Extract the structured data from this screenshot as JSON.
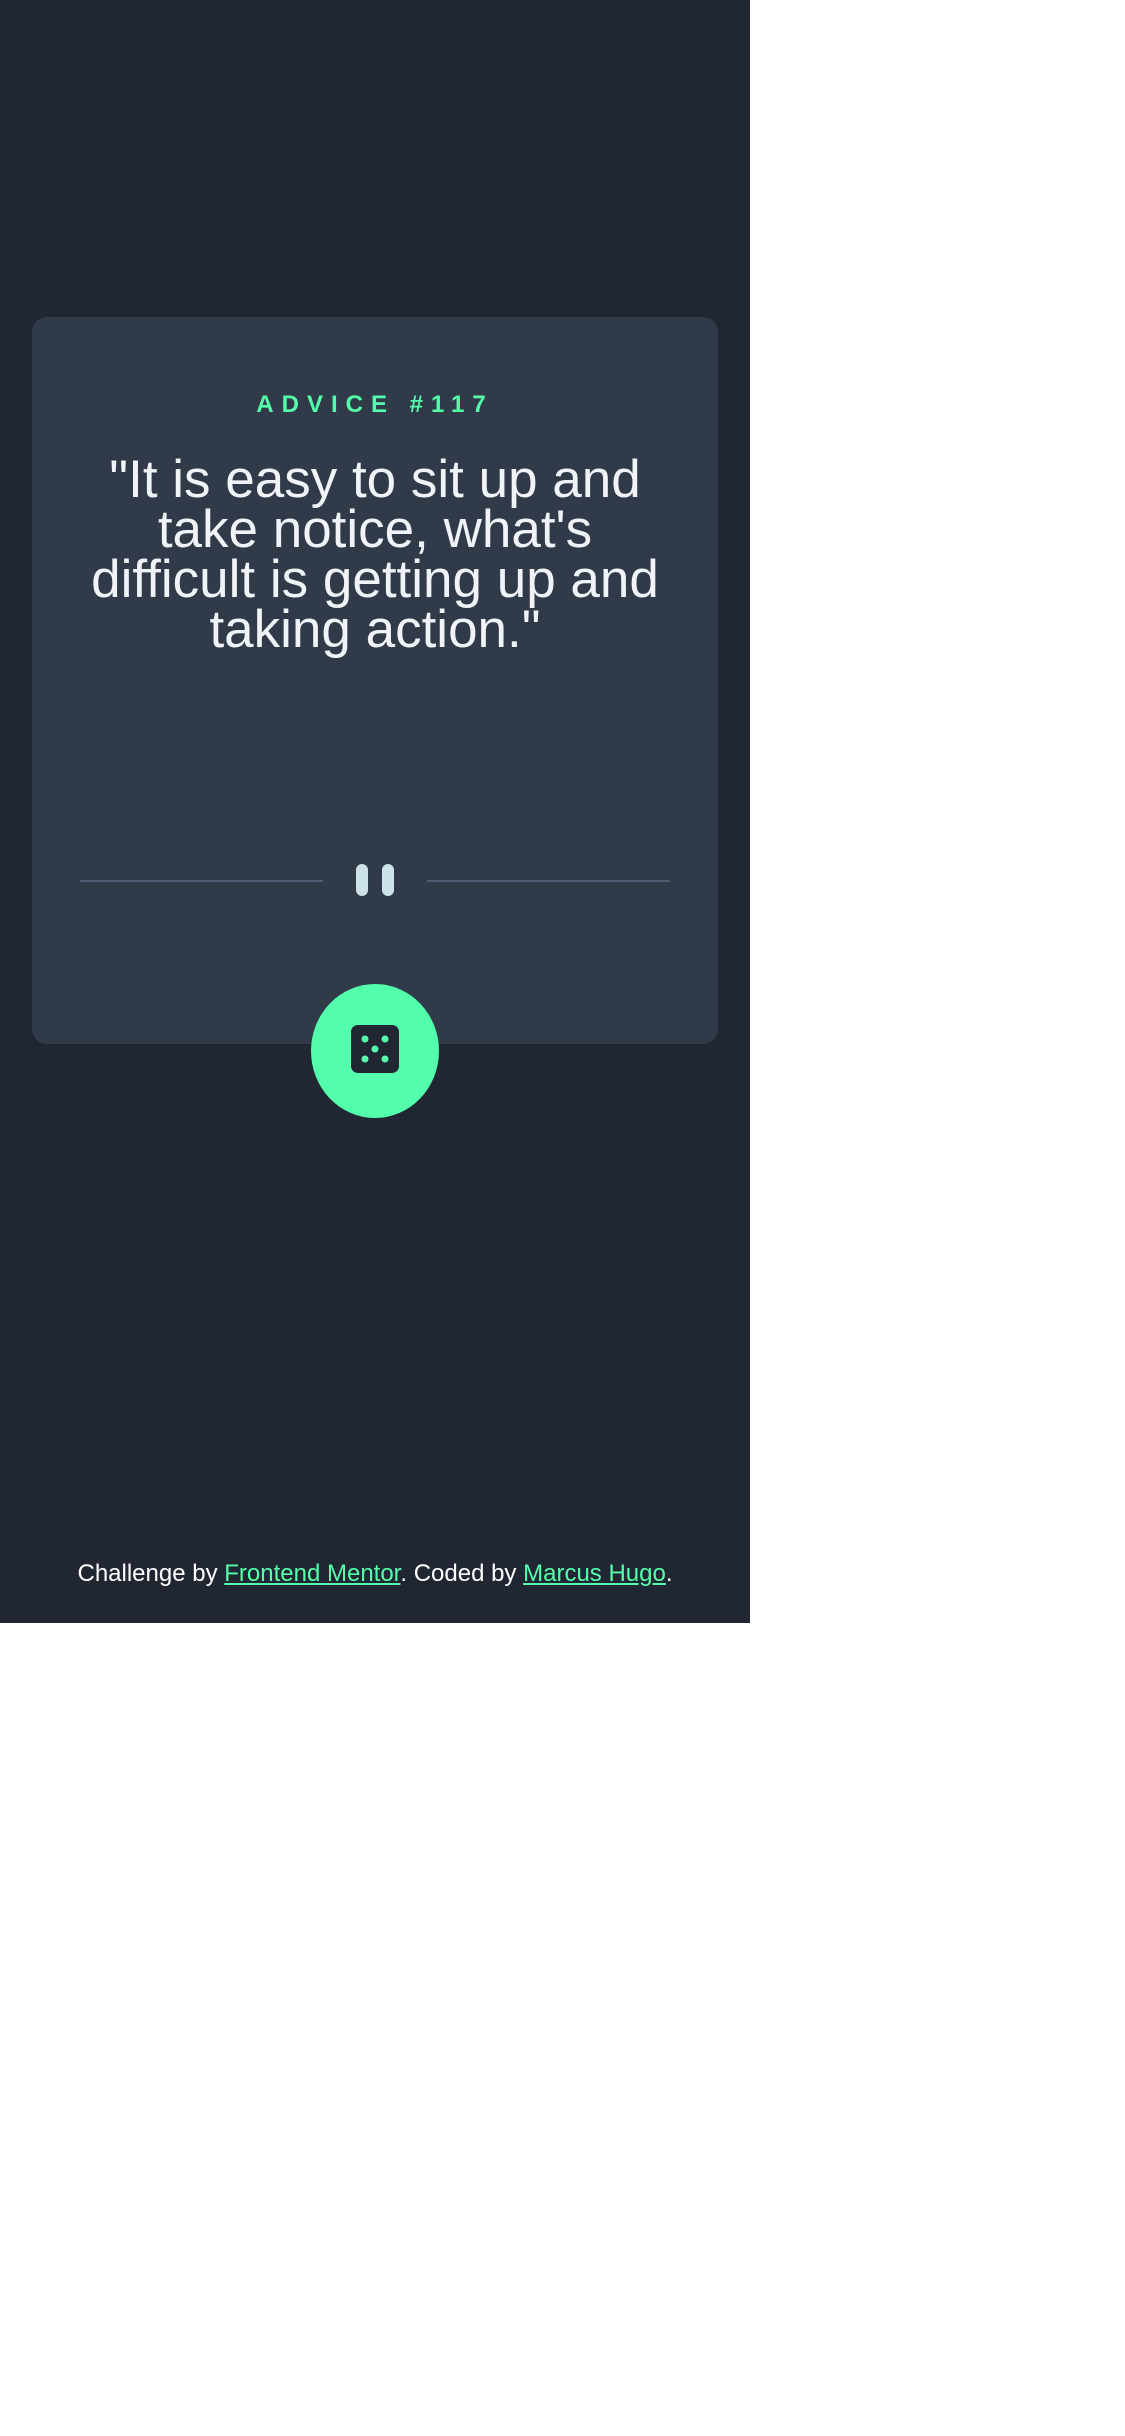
{
  "advice": {
    "id_label": "ADVICE #117",
    "quote": "\"It is easy to sit up and take notice, what's difficult is getting up and taking action.\""
  },
  "footer": {
    "prefix": "Challenge by ",
    "link1": "Frontend Mentor",
    "middle": ". Coded by ",
    "link2": "Marcus Hugo",
    "suffix": "."
  },
  "icons": {
    "divider": "pause-icon",
    "button": "dice-icon"
  },
  "colors": {
    "background": "#202733",
    "card": "#313a48",
    "accent": "#53ffaa",
    "text": "#f0f3f7",
    "divider_line": "#4f5d74",
    "pause": "#cee3e9"
  }
}
